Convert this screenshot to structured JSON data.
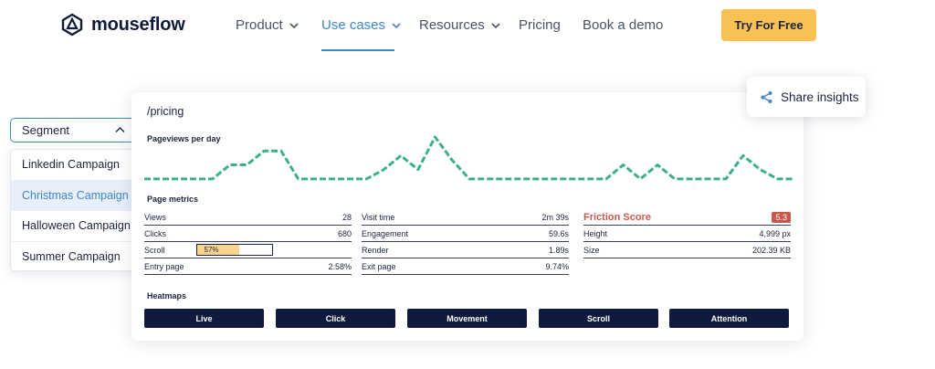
{
  "brand": {
    "name": "mouseflow"
  },
  "nav": {
    "items": [
      {
        "label": "Product",
        "has_chevron": true
      },
      {
        "label": "Use cases",
        "has_chevron": true,
        "active": true
      },
      {
        "label": "Resources",
        "has_chevron": true
      },
      {
        "label": "Pricing"
      },
      {
        "label": "Book a demo"
      }
    ],
    "cta_label": "Try For Free"
  },
  "segment": {
    "label": "Segment",
    "options": [
      "Linkedin Campaign",
      "Christmas Campaign",
      "Halloween Campaign",
      "Summer Campaign"
    ],
    "selected": "Christmas Campaign"
  },
  "share": {
    "label": "Share insights",
    "icon": "share-icon"
  },
  "card": {
    "path": "/pricing",
    "pageviews_title": "Pageviews per day",
    "metrics_title": "Page metrics",
    "metrics_left": [
      {
        "label": "Views",
        "value": "28"
      },
      {
        "label": "Clicks",
        "value": "680"
      },
      {
        "label": "Scroll",
        "value": "57%",
        "fraction": 0.57
      },
      {
        "label": "Entry page",
        "value": "2.58%"
      }
    ],
    "metrics_mid": [
      {
        "label": "Visit time",
        "value": "2m 39s"
      },
      {
        "label": "Engagement",
        "value": "59.6s"
      },
      {
        "label": "Render",
        "value": "1.89s"
      },
      {
        "label": "Exit page",
        "value": "9.74%"
      }
    ],
    "friction": {
      "label": "Friction Score",
      "value": "5.3"
    },
    "metrics_right": [
      {
        "label": "Height",
        "value": "4,999 px"
      },
      {
        "label": "Size",
        "value": "202.39 KB"
      }
    ],
    "heatmaps_title": "Heatmaps",
    "heatmaps": [
      "Live",
      "Click",
      "Movement",
      "Scroll",
      "Attention"
    ]
  },
  "colors": {
    "accent": "#3f86c9",
    "cta": "#f9c154",
    "line": "#3dae8e",
    "friction": "#c8574e",
    "navy": "#0f1a3d"
  },
  "chart_data": {
    "type": "line",
    "series": [
      {
        "values": [
          2,
          2,
          2,
          2,
          2,
          5,
          5,
          8,
          8,
          2,
          2,
          2,
          2,
          2,
          4,
          7,
          4,
          11,
          6,
          2,
          2,
          2,
          2,
          2,
          2,
          2,
          2,
          2,
          5,
          2,
          5,
          2,
          2,
          2,
          2,
          7,
          4,
          2,
          2
        ]
      }
    ]
  }
}
